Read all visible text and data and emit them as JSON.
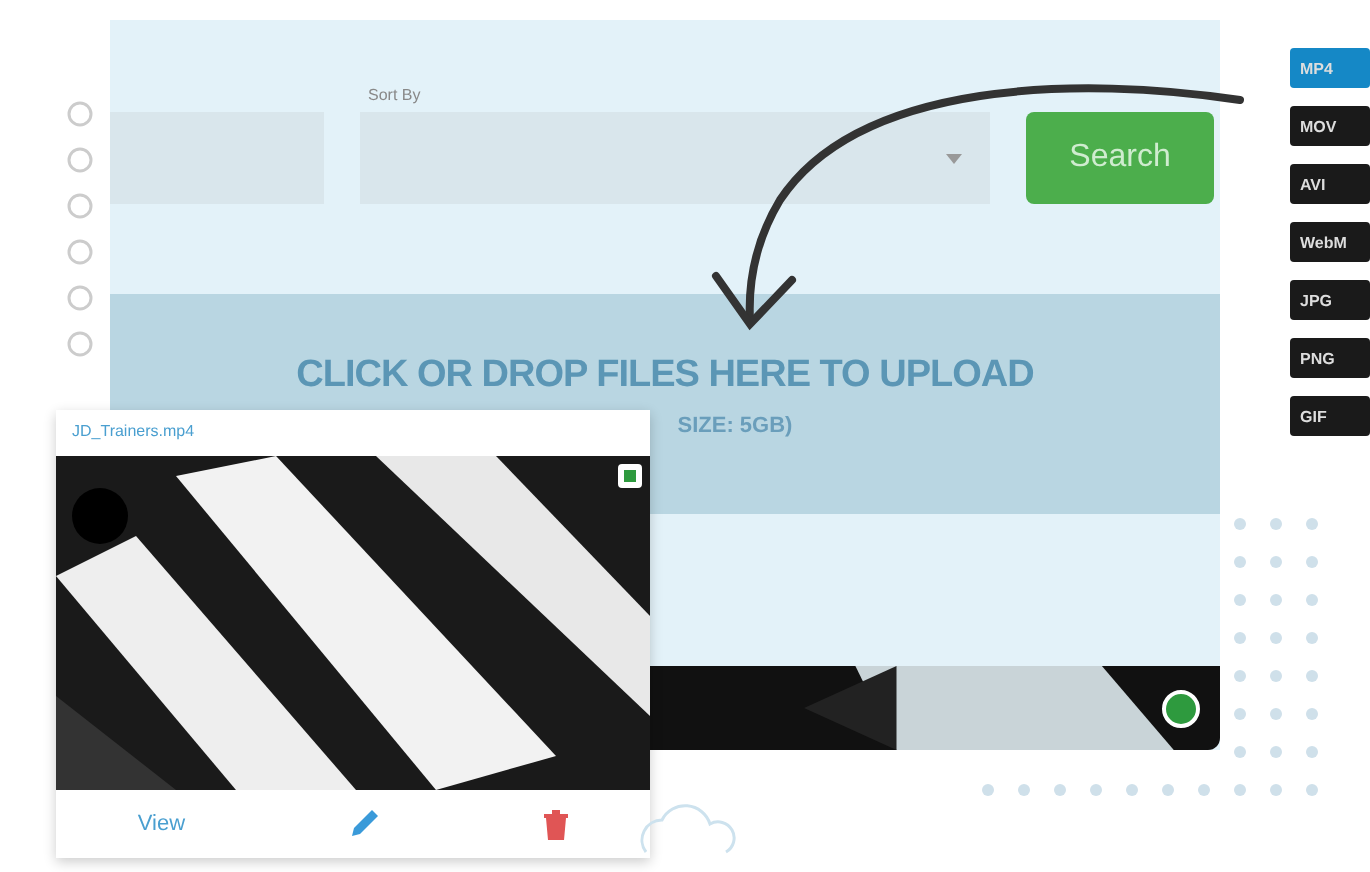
{
  "search_bar": {
    "sort_label": "Sort By",
    "search_button": "Search"
  },
  "upload_zone": {
    "title": "CLICK OR DROP FILES HERE TO UPLOAD",
    "subtitle": "SIZE: 5GB)"
  },
  "formats": [
    {
      "label": "MP4",
      "selected": true
    },
    {
      "label": "MOV",
      "selected": false
    },
    {
      "label": "AVI",
      "selected": false
    },
    {
      "label": "WebM",
      "selected": false
    },
    {
      "label": "JPG",
      "selected": false
    },
    {
      "label": "PNG",
      "selected": false
    },
    {
      "label": "GIF",
      "selected": false
    }
  ],
  "file_card": {
    "filename": "JD_Trainers.mp4",
    "view_link": "View"
  }
}
